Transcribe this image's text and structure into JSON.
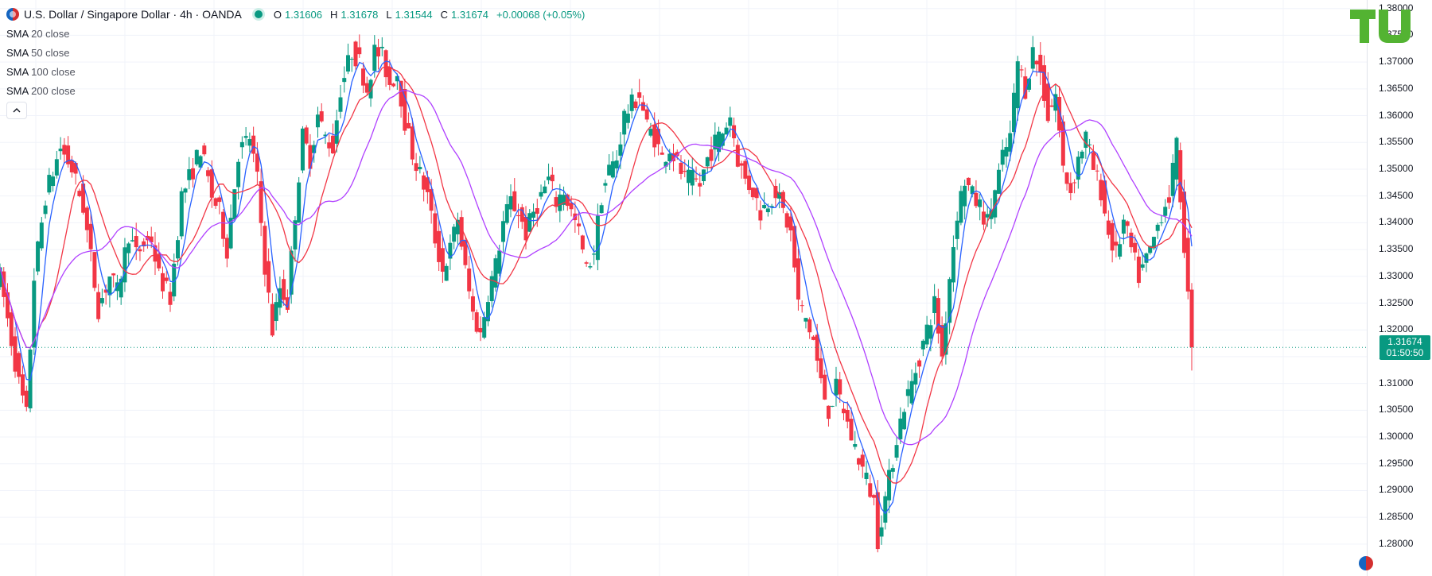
{
  "header": {
    "symbol_title": "U.S. Dollar / Singapore Dollar · 4h · OANDA",
    "open_label": "O",
    "open_value": "1.31606",
    "high_label": "H",
    "high_value": "1.31678",
    "low_label": "L",
    "low_value": "1.31544",
    "close_label": "C",
    "close_value": "1.31674",
    "change": "+0.00068 (+0.05%)"
  },
  "indicators": [
    {
      "name": "SMA",
      "params": "20 close",
      "color": "#2962ff"
    },
    {
      "name": "SMA",
      "params": "50 close",
      "color": "#f23645"
    },
    {
      "name": "SMA",
      "params": "100 close",
      "color": "#f23645"
    },
    {
      "name": "SMA",
      "params": "200 close",
      "color": "#9c27b0"
    }
  ],
  "price_badge": {
    "price": "1.31674",
    "countdown": "01:50:50"
  },
  "colors": {
    "up": "#089981",
    "down": "#f23645",
    "sma20": "#2962ff",
    "sma50": "#f23645",
    "sma200": "#b040ff",
    "grid": "#f0f3fa"
  },
  "chart_data": {
    "type": "candlestick",
    "y_ticks": [
      "1.38000",
      "1.37500",
      "1.37000",
      "1.36500",
      "1.36000",
      "1.35500",
      "1.35000",
      "1.34500",
      "1.34000",
      "1.33500",
      "1.33000",
      "1.32500",
      "1.32000",
      "1.31500",
      "1.31000",
      "1.30500",
      "1.30000",
      "1.29500",
      "1.29000",
      "1.28500",
      "1.28000"
    ],
    "ylim": [
      1.2785,
      1.3807
    ],
    "current_price": 1.31674,
    "close_path": [
      [
        0,
        1.33
      ],
      [
        3,
        1.318
      ],
      [
        5,
        1.31
      ],
      [
        7,
        1.304
      ],
      [
        9,
        1.33
      ],
      [
        12,
        1.345
      ],
      [
        16,
        1.354
      ],
      [
        19,
        1.35
      ],
      [
        22,
        1.343
      ],
      [
        26,
        1.324
      ],
      [
        29,
        1.33
      ],
      [
        31,
        1.327
      ],
      [
        34,
        1.338
      ],
      [
        36,
        1.334
      ],
      [
        38,
        1.336
      ],
      [
        40,
        1.337
      ],
      [
        42,
        1.33
      ],
      [
        45,
        1.326
      ],
      [
        48,
        1.345
      ],
      [
        51,
        1.35
      ],
      [
        53,
        1.354
      ],
      [
        56,
        1.345
      ],
      [
        58,
        1.342
      ],
      [
        60,
        1.335
      ],
      [
        63,
        1.353
      ],
      [
        66,
        1.356
      ],
      [
        68,
        1.348
      ],
      [
        70,
        1.332
      ],
      [
        72,
        1.32
      ],
      [
        74,
        1.328
      ],
      [
        76,
        1.325
      ],
      [
        78,
        1.342
      ],
      [
        80,
        1.356
      ],
      [
        82,
        1.352
      ],
      [
        84,
        1.36
      ],
      [
        86,
        1.356
      ],
      [
        88,
        1.354
      ],
      [
        90,
        1.365
      ],
      [
        93,
        1.372
      ],
      [
        95,
        1.37
      ],
      [
        97,
        1.365
      ],
      [
        99,
        1.372
      ],
      [
        101,
        1.371
      ],
      [
        103,
        1.366
      ],
      [
        105,
        1.368
      ],
      [
        107,
        1.359
      ],
      [
        109,
        1.353
      ],
      [
        111,
        1.349
      ],
      [
        113,
        1.345
      ],
      [
        115,
        1.337
      ],
      [
        117,
        1.331
      ],
      [
        119,
        1.335
      ],
      [
        121,
        1.341
      ],
      [
        123,
        1.331
      ],
      [
        125,
        1.323
      ],
      [
        127,
        1.319
      ],
      [
        129,
        1.327
      ],
      [
        131,
        1.332
      ],
      [
        133,
        1.34
      ],
      [
        135,
        1.344
      ],
      [
        137,
        1.342
      ],
      [
        139,
        1.338
      ],
      [
        141,
        1.342
      ],
      [
        143,
        1.345
      ],
      [
        145,
        1.348
      ],
      [
        147,
        1.344
      ],
      [
        149,
        1.346
      ],
      [
        151,
        1.342
      ],
      [
        153,
        1.338
      ],
      [
        155,
        1.331
      ],
      [
        157,
        1.335
      ],
      [
        159,
        1.345
      ],
      [
        161,
        1.35
      ],
      [
        163,
        1.352
      ],
      [
        165,
        1.36
      ],
      [
        167,
        1.362
      ],
      [
        169,
        1.364
      ],
      [
        171,
        1.358
      ],
      [
        173,
        1.356
      ],
      [
        175,
        1.352
      ],
      [
        177,
        1.354
      ],
      [
        179,
        1.351
      ],
      [
        181,
        1.348
      ],
      [
        183,
        1.348
      ],
      [
        185,
        1.347
      ],
      [
        187,
        1.352
      ],
      [
        189,
        1.355
      ],
      [
        191,
        1.357
      ],
      [
        193,
        1.36
      ],
      [
        195,
        1.352
      ],
      [
        197,
        1.348
      ],
      [
        199,
        1.346
      ],
      [
        201,
        1.342
      ],
      [
        203,
        1.344
      ],
      [
        205,
        1.346
      ],
      [
        207,
        1.342
      ],
      [
        209,
        1.338
      ],
      [
        211,
        1.325
      ],
      [
        213,
        1.322
      ],
      [
        215,
        1.318
      ],
      [
        217,
        1.31
      ],
      [
        219,
        1.305
      ],
      [
        221,
        1.309
      ],
      [
        223,
        1.305
      ],
      [
        225,
        1.3
      ],
      [
        227,
        1.296
      ],
      [
        229,
        1.292
      ],
      [
        231,
        1.288
      ],
      [
        232,
        1.281
      ],
      [
        233,
        1.285
      ],
      [
        235,
        1.292
      ],
      [
        237,
        1.3
      ],
      [
        239,
        1.306
      ],
      [
        241,
        1.31
      ],
      [
        243,
        1.315
      ],
      [
        245,
        1.32
      ],
      [
        247,
        1.325
      ],
      [
        249,
        1.315
      ],
      [
        251,
        1.33
      ],
      [
        253,
        1.342
      ],
      [
        255,
        1.348
      ],
      [
        257,
        1.345
      ],
      [
        259,
        1.343
      ],
      [
        261,
        1.34
      ],
      [
        263,
        1.346
      ],
      [
        265,
        1.352
      ],
      [
        267,
        1.356
      ],
      [
        269,
        1.37
      ],
      [
        271,
        1.365
      ],
      [
        273,
        1.372
      ],
      [
        275,
        1.368
      ],
      [
        277,
        1.36
      ],
      [
        279,
        1.364
      ],
      [
        281,
        1.35
      ],
      [
        283,
        1.346
      ],
      [
        285,
        1.352
      ],
      [
        287,
        1.356
      ],
      [
        289,
        1.35
      ],
      [
        291,
        1.346
      ],
      [
        293,
        1.338
      ],
      [
        295,
        1.334
      ],
      [
        297,
        1.34
      ],
      [
        299,
        1.335
      ],
      [
        301,
        1.33
      ],
      [
        303,
        1.333
      ],
      [
        305,
        1.337
      ],
      [
        307,
        1.342
      ],
      [
        309,
        1.345
      ],
      [
        311,
        1.354
      ],
      [
        313,
        1.336
      ],
      [
        315,
        1.316
      ]
    ]
  }
}
